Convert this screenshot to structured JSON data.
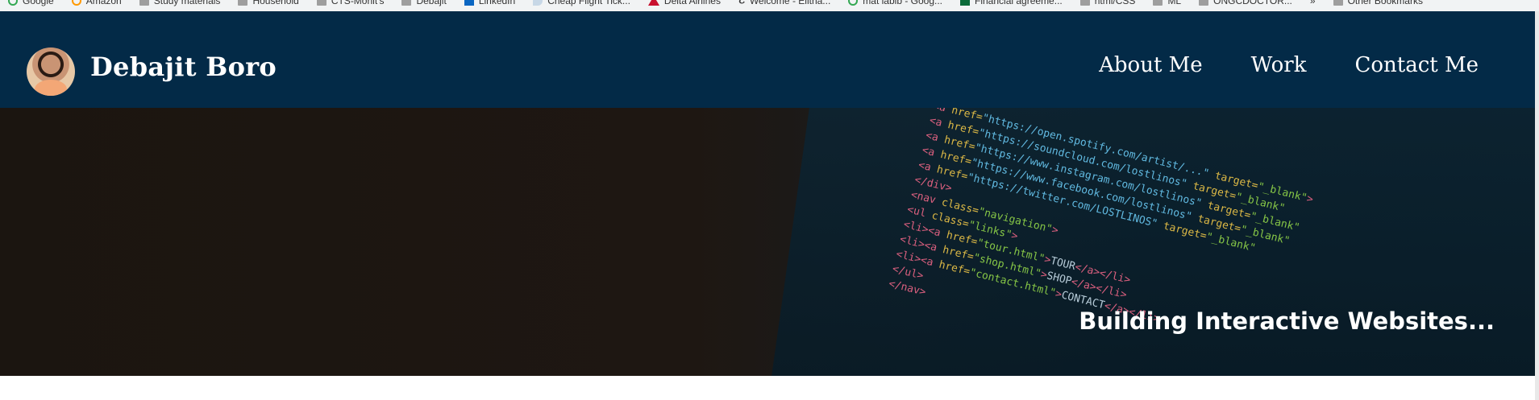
{
  "bookmarks": [
    {
      "label": "Google",
      "icon": "google-icon"
    },
    {
      "label": "Amazon",
      "icon": "amazon-icon"
    },
    {
      "label": "Study materials",
      "icon": "folder-icon"
    },
    {
      "label": "Household",
      "icon": "folder-icon"
    },
    {
      "label": "CTS-Mohit's",
      "icon": "folder-icon"
    },
    {
      "label": "Debajit",
      "icon": "folder-icon"
    },
    {
      "label": "LinkedIn",
      "icon": "linkedin-icon"
    },
    {
      "label": "Cheap Flight Tick...",
      "icon": "feather-icon"
    },
    {
      "label": "Delta Airlines",
      "icon": "delta-icon"
    },
    {
      "label": "Welcome - Elitha...",
      "icon": "nyt-icon"
    },
    {
      "label": "mat labib - Goog...",
      "icon": "google-icon"
    },
    {
      "label": "Financial agreeme...",
      "icon": "green-icon"
    },
    {
      "label": "html/CSS",
      "icon": "folder-icon"
    },
    {
      "label": "ML",
      "icon": "folder-icon"
    },
    {
      "label": "ONGCDOCTOR...",
      "icon": "folder-icon"
    },
    {
      "label": "»",
      "icon": "overflow-icon"
    },
    {
      "label": "Other Bookmarks",
      "icon": "folder-icon"
    }
  ],
  "header": {
    "site_title": "Debajit Boro",
    "nav": [
      "About Me",
      "Work",
      "Contact Me"
    ]
  },
  "hero": {
    "tagline": "Building Interactive Websites..."
  },
  "colors": {
    "header_bg": "#032a47",
    "text": "#ffffff"
  }
}
